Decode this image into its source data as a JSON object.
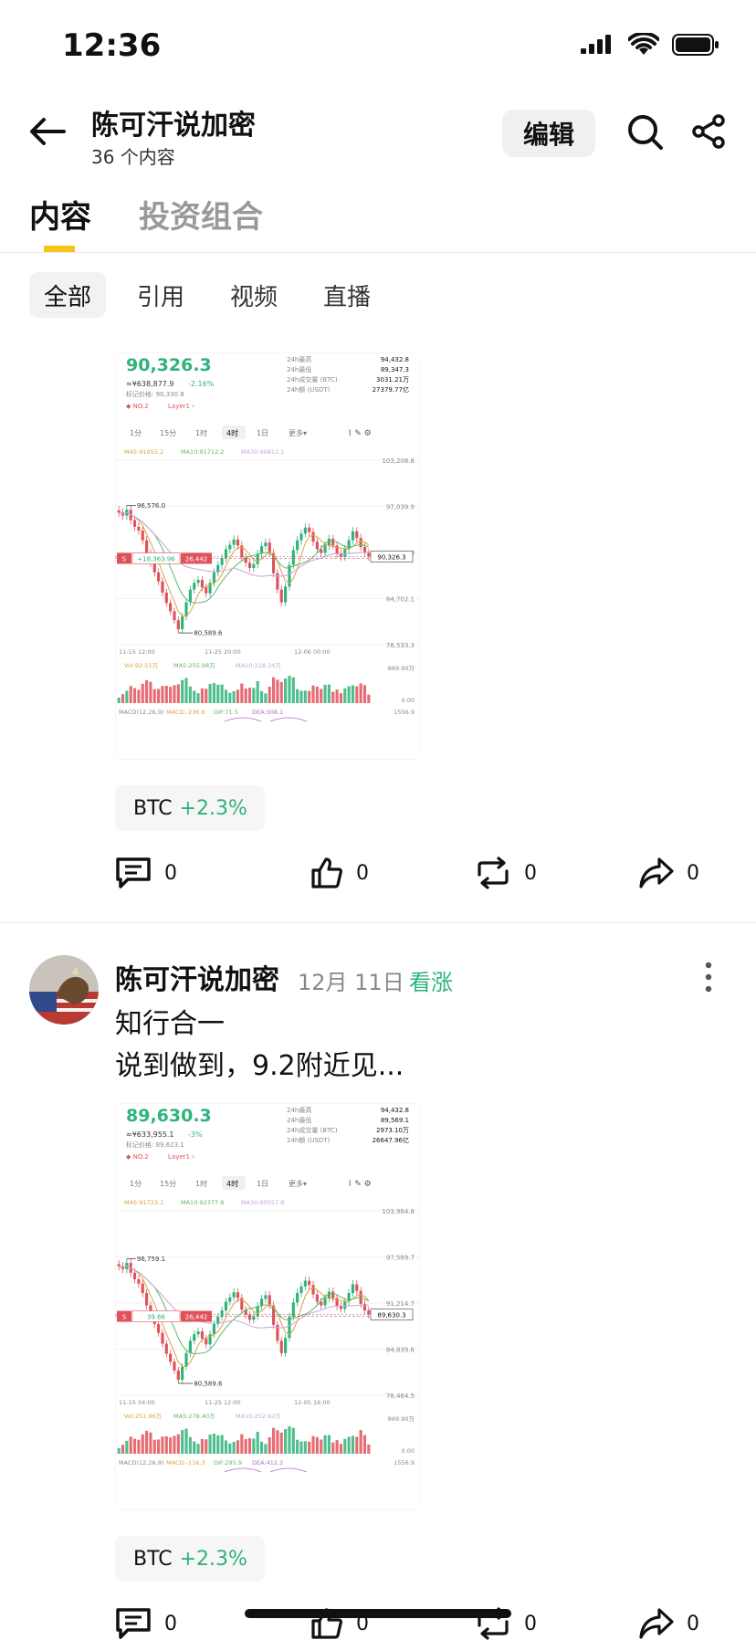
{
  "status_bar": {
    "time": "12:36"
  },
  "header": {
    "title": "陈可汗说加密",
    "subtitle": "36 个内容",
    "edit_label": "编辑"
  },
  "tabs": [
    {
      "label": "内容",
      "active": true
    },
    {
      "label": "投资组合",
      "active": false
    }
  ],
  "filters": [
    {
      "label": "全部",
      "active": true
    },
    {
      "label": "引用"
    },
    {
      "label": "视频"
    },
    {
      "label": "直播"
    }
  ],
  "colors": {
    "accent": "#f5c518",
    "up_green": "#2fb37a",
    "down_red": "#e0525b"
  },
  "posts": [
    {
      "chart": {
        "price": "90,326.3",
        "cny": "≈¥638,877.9",
        "change": "-2.16%",
        "mark_price": "标记价格: 90,330.8",
        "rank": "NO.2",
        "category": "Layer1",
        "stats": [
          {
            "label": "24h最高",
            "value": "94,432.8"
          },
          {
            "label": "24h最低",
            "value": "89,347.3"
          },
          {
            "label": "24h成交量 (BTC)",
            "value": "3031.21万"
          },
          {
            "label": "24h额 (USDT)",
            "value": "27379.77亿"
          }
        ],
        "intervals": [
          "1分",
          "15分",
          "1时",
          "4时",
          "1日",
          "更多▾"
        ],
        "ma_line": [
          "MA5:91055.2",
          "MA10:91712.2",
          "MA30:90812.1"
        ],
        "y_ticks": [
          "103,208.8",
          "97,039.9",
          "90,871.0",
          "84,702.1",
          "78,533.3"
        ],
        "high_label": "96,576.0",
        "low_label": "80,589.6",
        "position_line": "+18,363.96",
        "position_qty": "26,442",
        "last_price_tag": "90,326.3",
        "x_ticks": [
          "11-15 12:00",
          "11-25 20:00",
          "12-06 00:00"
        ],
        "vol_line": [
          "Vol:92.51万",
          "MA5:255.98万",
          "MA10:218.34万"
        ],
        "vol_ticks": [
          "869.90万",
          "0.00"
        ],
        "macd_line": [
          "MACD(12,26,9)",
          "MACD:-236.6",
          "DIF:71.5",
          "DEA:308.1"
        ],
        "macd_tick": "1556.9",
        "candles": [
          96200,
          95800,
          96576,
          95200,
          94300,
          93800,
          92500,
          90800,
          89500,
          88200,
          87000,
          85500,
          84100,
          83000,
          81800,
          80589.6,
          82300,
          84200,
          85900,
          86800,
          87200,
          86200,
          85400,
          86800,
          88200,
          89200,
          90100,
          91300,
          91900,
          92600,
          91800,
          90200,
          89500,
          88800,
          89300,
          90700,
          91700,
          92200,
          90800,
          88100,
          85900,
          84200,
          86300,
          89200,
          91200,
          92500,
          93400,
          94200,
          93600,
          92300,
          91300,
          90800,
          91800,
          92700,
          91800,
          90700,
          90300,
          91300,
          92500,
          93700,
          92800,
          91600,
          90800,
          90326.3
        ]
      },
      "ticker": {
        "symbol": "BTC",
        "change": "+2.3%"
      },
      "actions": {
        "comments": "0",
        "likes": "0",
        "reposts": "0",
        "shares": "0"
      }
    },
    {
      "author": "陈可汗说加密",
      "date": "12月 11日",
      "sentiment": "看涨",
      "text_lines": [
        "知行合一",
        "说到做到，9.2附近见..."
      ],
      "chart": {
        "price": "89,630.3",
        "cny": "≈¥633,955.1",
        "change": "-3%",
        "mark_price": "标记价格: 89,623.1",
        "rank": "NO.2",
        "category": "Layer1",
        "stats": [
          {
            "label": "24h最高",
            "value": "94,432.8"
          },
          {
            "label": "24h最低",
            "value": "89,569.1"
          },
          {
            "label": "24h成交量 (BTC)",
            "value": "2973.10万"
          },
          {
            "label": "24h额 (USDT)",
            "value": "26647.96亿"
          }
        ],
        "intervals": [
          "1分",
          "15分",
          "1时",
          "4时",
          "1日",
          "更多▾"
        ],
        "ma_line": [
          "MA5:91723.1",
          "MA10:92377.8",
          "MA30:90557.8"
        ],
        "y_ticks": [
          "103,964.8",
          "97,589.7",
          "91,214.7",
          "84,839.6",
          "78,464.5"
        ],
        "high_label": "96,759.1",
        "low_label": "80,589.6",
        "position_line": "39.66",
        "position_qty": "26,442",
        "last_price_tag": "89,630.3",
        "x_ticks": [
          "11-15 04:00",
          "11-25 12:00",
          "12-05 16:00"
        ],
        "vol_line": [
          "Vol:251.96万",
          "MA5:278.40万",
          "MA10:252.92万"
        ],
        "vol_ticks": [
          "869.90万",
          "0.00"
        ],
        "macd_line": [
          "MACD(12,26,9)",
          "MACD:-116.3",
          "DIF:295.9",
          "DEA:412.2"
        ],
        "macd_tick": "1556.9",
        "candles": [
          96300,
          95900,
          96759.1,
          95400,
          94500,
          93900,
          92600,
          90900,
          89600,
          88300,
          87100,
          85600,
          84200,
          83100,
          81900,
          80589.6,
          82400,
          84300,
          86000,
          86900,
          87300,
          86300,
          85500,
          86900,
          88300,
          89300,
          90200,
          91400,
          92000,
          92700,
          91900,
          90300,
          89600,
          88900,
          89400,
          90800,
          91800,
          92300,
          90900,
          88200,
          86000,
          84300,
          86400,
          89300,
          91300,
          92600,
          93500,
          94300,
          93700,
          92400,
          91400,
          90900,
          91900,
          92800,
          91900,
          90800,
          90400,
          91400,
          92600,
          93800,
          92900,
          91100,
          90200,
          89630.3
        ]
      },
      "ticker": {
        "symbol": "BTC",
        "change": "+2.3%"
      },
      "actions": {
        "comments": "0",
        "likes": "0",
        "reposts": "0",
        "shares": "0"
      }
    }
  ]
}
